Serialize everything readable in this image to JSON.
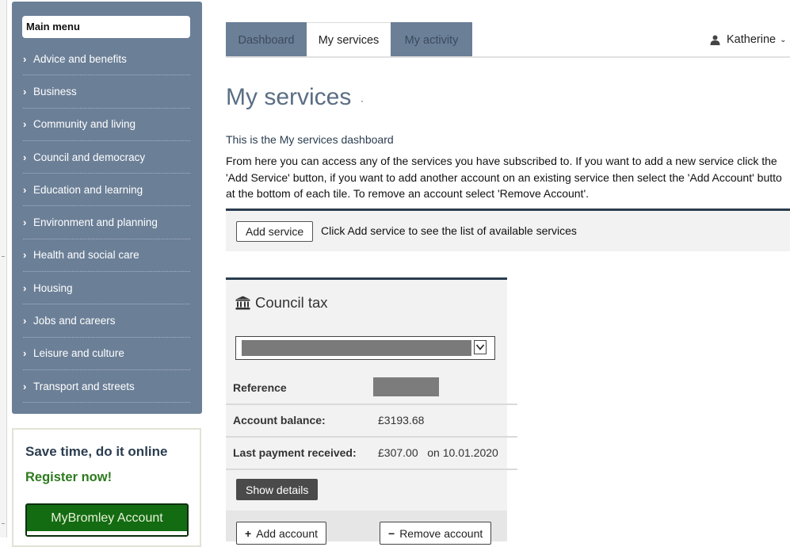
{
  "sidebar": {
    "main_menu": "Main menu",
    "items": [
      {
        "label": "Advice and benefits"
      },
      {
        "label": "Business"
      },
      {
        "label": "Community and living"
      },
      {
        "label": "Council and democracy"
      },
      {
        "label": "Education and learning"
      },
      {
        "label": "Environment and planning"
      },
      {
        "label": "Health and social care"
      },
      {
        "label": "Housing"
      },
      {
        "label": "Jobs and careers"
      },
      {
        "label": "Leisure and culture"
      },
      {
        "label": "Transport and streets"
      }
    ]
  },
  "promo": {
    "title": "Save time, do it online",
    "register": "Register now!",
    "button": "MyBromley Account"
  },
  "tabs": [
    {
      "label": "Dashboard",
      "state": "inactive"
    },
    {
      "label": "My services",
      "state": "active"
    },
    {
      "label": "My activity",
      "state": "inactive"
    }
  ],
  "user": {
    "name": "Katherine",
    "icon": "user-icon"
  },
  "main": {
    "title": "My services",
    "subhead": "This is the My services dashboard",
    "description": [
      "From here you can access any of the services you have subscribed to. If you want to add a new service click the",
      "'Add Service' button, if you want to add another account on an existing service then select the 'Add Account' butto",
      "at the bottom of each tile. To remove an account select 'Remove Account'."
    ],
    "add_service_label": "Add service",
    "add_service_hint": "Click Add service to see the list of available services"
  },
  "council_tax": {
    "title": "Council tax",
    "icon": "bank-icon",
    "rows": [
      {
        "label": "Reference",
        "value": ""
      },
      {
        "label": "Account balance:",
        "value": "£3193.68"
      },
      {
        "label": "Last payment received:",
        "value": "£307.00   on 10.01.2020"
      }
    ],
    "show_details_label": "Show details",
    "add_account_label": "Add account",
    "remove_account_label": "Remove account"
  },
  "colors": {
    "sidebar": "#6b7f97",
    "title": "#5a6e84",
    "panel_border": "#2b3d4f",
    "promo_green": "#136b12"
  }
}
